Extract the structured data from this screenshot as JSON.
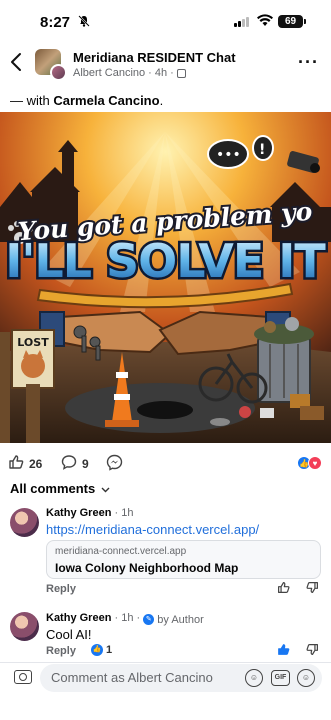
{
  "status_bar": {
    "time": "8:27",
    "battery": "69"
  },
  "header": {
    "group_name": "Meridiana RESIDENT Chat",
    "author": "Albert Cancino",
    "timestamp": "4h"
  },
  "post": {
    "with_prefix": "— with",
    "with_name": "Carmela Cancino",
    "image_text": {
      "line1": "You got a problem yo",
      "line2": "I'LL SOLVE IT",
      "sign": "LOST"
    }
  },
  "stats": {
    "likes": "26",
    "comments": "9"
  },
  "comments_filter": "All comments",
  "comments": [
    {
      "author": "Kathy Green",
      "time": "1h",
      "link_text": "https://meridiana-connect.vercel.app/",
      "preview_domain": "meridiana-connect.vercel.app",
      "preview_title": "Iowa Colony Neighborhood Map",
      "reply_label": "Reply"
    },
    {
      "author": "Kathy Green",
      "time": "1h",
      "badge": "by Author",
      "text": "Cool AI!",
      "reply_label": "Reply",
      "like_count": "1"
    }
  ],
  "composer": {
    "placeholder": "Comment as Albert Cancino",
    "gif_label": "GIF"
  },
  "colors": {
    "link": "#216fdb",
    "like_blue": "#1877f2",
    "love_red": "#f33e58"
  }
}
